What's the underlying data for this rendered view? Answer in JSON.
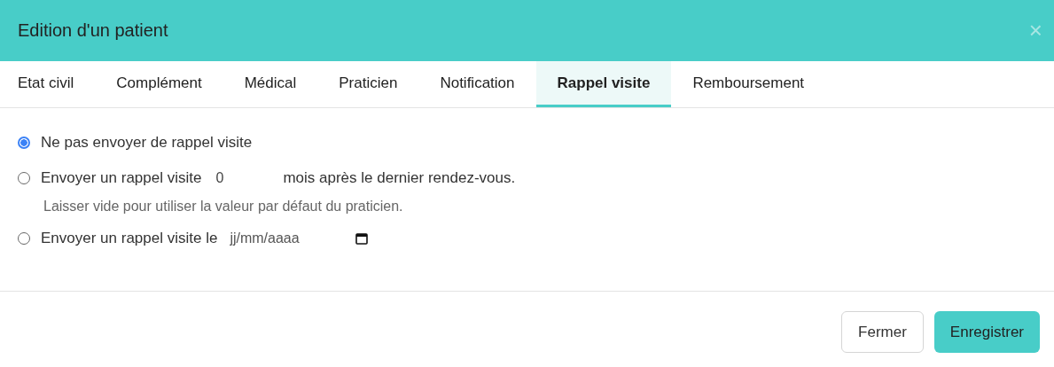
{
  "window": {
    "title": "Edition d'un patient",
    "close": "×"
  },
  "tabs": [
    {
      "label": "Etat civil",
      "selected": false
    },
    {
      "label": "Complément",
      "selected": false
    },
    {
      "label": "Médical",
      "selected": false
    },
    {
      "label": "Praticien",
      "selected": false
    },
    {
      "label": "Notification",
      "selected": false
    },
    {
      "label": "Rappel visite",
      "selected": true
    },
    {
      "label": "Remboursement",
      "selected": false
    }
  ],
  "options": [
    {
      "kind": "plain",
      "label": "Ne pas envoyer de rappel visite",
      "selected": true
    },
    {
      "kind": "months",
      "label": "Envoyer un rappel visite",
      "value": "0",
      "after": "mois après le dernier rendez-vous.",
      "hint": "Laisser vide pour utiliser la valeur par défaut du praticien.",
      "selected": false
    },
    {
      "kind": "date",
      "label": "Envoyer un rappel visite le",
      "placeholder": "jj/mm/aaaa",
      "selected": false
    }
  ],
  "buttons": [
    {
      "label": "Fermer",
      "kind": "secondary"
    },
    {
      "label": "Enregistrer",
      "kind": "primary"
    }
  ]
}
